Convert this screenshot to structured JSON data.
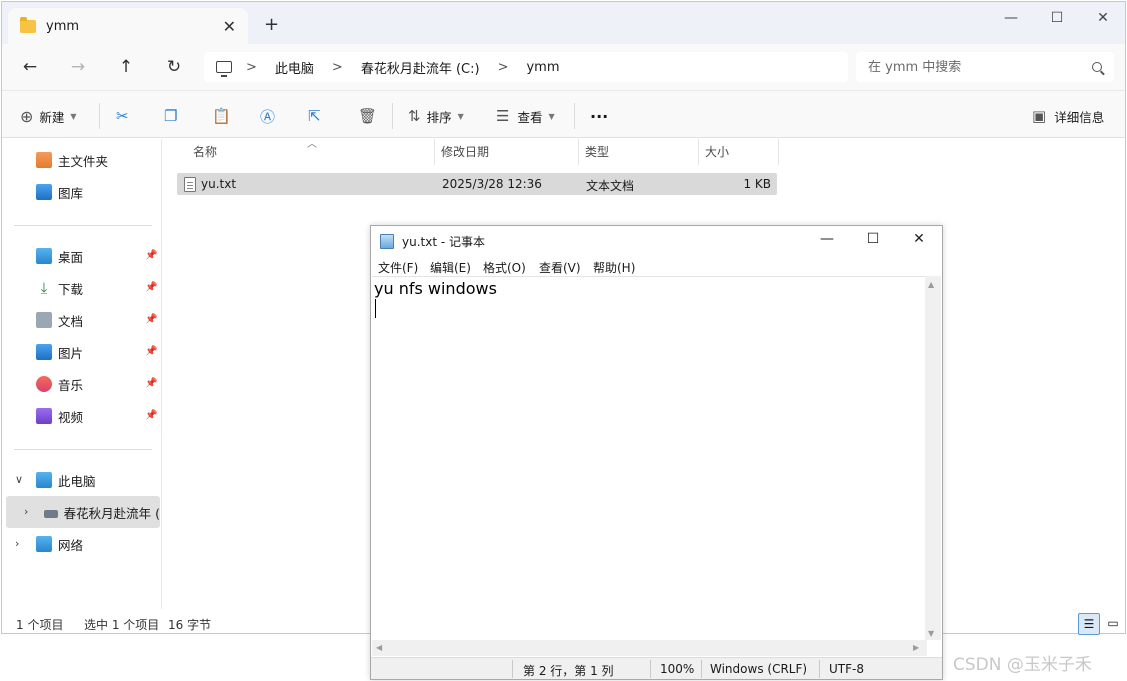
{
  "explorer": {
    "tab_title": "ymm",
    "new_tab": "+",
    "window_controls": {
      "minimize": "—",
      "maximize": "☐",
      "close": "✕"
    },
    "tab_close": "✕",
    "nav": {
      "back": "←",
      "forward": "→",
      "up": "↑",
      "refresh": "↻"
    },
    "breadcrumb": [
      "此电脑",
      "春花秋月赴流年 (C:)",
      "ymm"
    ],
    "breadcrumb_sep": ">",
    "search_placeholder": "在 ymm 中搜索",
    "toolbar": {
      "new": "新建",
      "sort": "排序",
      "view": "查看",
      "more": "···",
      "details": "详细信息"
    },
    "sidebar": {
      "home": "主文件夹",
      "gallery": "图库",
      "desktop": "桌面",
      "downloads": "下载",
      "documents": "文档",
      "pictures": "图片",
      "music": "音乐",
      "videos": "视频",
      "this_pc": "此电脑",
      "drive": "春花秋月赴流年 (",
      "network": "网络"
    },
    "columns": {
      "name": "名称",
      "modified": "修改日期",
      "type": "类型",
      "size": "大小"
    },
    "files": [
      {
        "name": "yu.txt",
        "modified": "2025/3/28 12:36",
        "type": "文本文档",
        "size": "1 KB"
      }
    ],
    "status": {
      "count": "1 个项目",
      "selected": "选中 1 个项目",
      "bytes": "16 字节"
    }
  },
  "notepad": {
    "title": "yu.txt - 记事本",
    "controls": {
      "minimize": "—",
      "maximize": "☐",
      "close": "✕"
    },
    "menu": [
      "文件(F)",
      "编辑(E)",
      "格式(O)",
      "查看(V)",
      "帮助(H)"
    ],
    "content": "yu nfs windows",
    "status": {
      "position": "第 2 行，第 1 列",
      "zoom": "100%",
      "line_ending": "Windows (CRLF)",
      "encoding": "UTF-8"
    }
  },
  "watermark": "CSDN @玉米子禾",
  "colors": {
    "accent": "#2f7fd6",
    "selected_row": "#d9d9d9",
    "titlebar": "#eef2f8"
  }
}
